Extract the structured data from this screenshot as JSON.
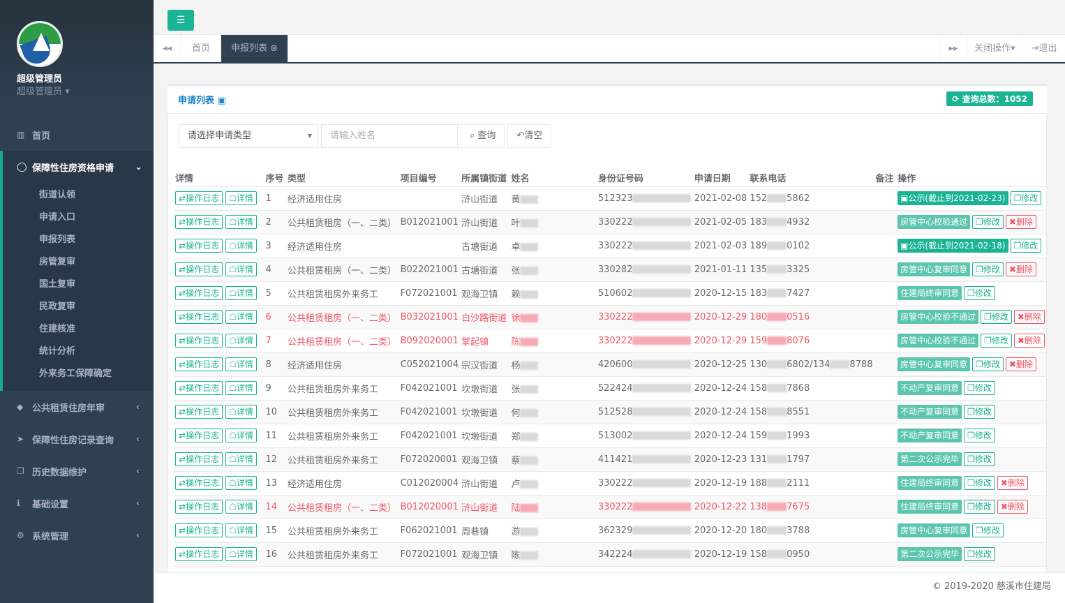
{
  "user": {
    "name": "超级管理员",
    "role": "超级管理员"
  },
  "nav": {
    "home": "首页",
    "active": "保障性住房资格申请",
    "sub": [
      "街道认领",
      "申请入口",
      "申报列表",
      "房管复审",
      "国土复审",
      "民政复审",
      "住建核准",
      "统计分析",
      "外来务工保障确定"
    ],
    "rest": [
      "公共租赁住房年审",
      "保障性住房记录查询",
      "历史数据维护",
      "基础设置",
      "系统管理"
    ]
  },
  "tabs": {
    "home": "首页",
    "active": "申报列表",
    "close_ops": "关闭操作",
    "logout": "退出"
  },
  "panel": {
    "title": "申请列表",
    "count": "查询总数：1052"
  },
  "search": {
    "type_placeholder": "请选择申请类型",
    "name_placeholder": "请输入姓名",
    "query": "查询",
    "clear": "清空"
  },
  "columns": [
    "详情",
    "序号",
    "类型",
    "项目编号",
    "所属镇街道",
    "姓名",
    "身份证号码",
    "申请日期",
    "联系电话",
    "备注",
    "操作"
  ],
  "row_buttons": {
    "log": "操作日志",
    "detail": "详情",
    "edit": "修改",
    "delete": "删除"
  },
  "rows": [
    {
      "no": "1",
      "type": "经济适用住房",
      "proj": "",
      "street": "浒山街道",
      "name": "黄",
      "id": "512323",
      "date": "2021-02-08",
      "p1": "152",
      "p2": "5862",
      "status": "公示(截止到2021-02-23)",
      "del": false,
      "red": false
    },
    {
      "no": "2",
      "type": "公共租赁租房（一、二类）",
      "proj": "B012021001",
      "street": "浒山街道",
      "name": "叶",
      "id": "330222",
      "date": "2021-02-05",
      "p1": "183",
      "p2": "4932",
      "status": "房管中心校验通过",
      "del": true,
      "red": false
    },
    {
      "no": "3",
      "type": "经济适用住房",
      "proj": "",
      "street": "古塘街道",
      "name": "卓",
      "id": "330222",
      "date": "2021-02-03",
      "p1": "189",
      "p2": "0102",
      "status": "公示(截止到2021-02-18)",
      "del": false,
      "red": false
    },
    {
      "no": "4",
      "type": "公共租赁租房（一、二类）",
      "proj": "B022021001",
      "street": "古塘街道",
      "name": "张",
      "id": "330282",
      "date": "2021-01-11",
      "p1": "135",
      "p2": "3325",
      "status": "房管中心复审同意",
      "del": true,
      "red": false
    },
    {
      "no": "5",
      "type": "公共租赁租房外来务工",
      "proj": "F072021001",
      "street": "观海卫镇",
      "name": "赖",
      "id": "510602",
      "date": "2020-12-15",
      "p1": "183",
      "p2": "7427",
      "status": "住建局终审同意",
      "del": false,
      "red": false
    },
    {
      "no": "6",
      "type": "公共租赁租房（一、二类）",
      "proj": "B032021001",
      "street": "白沙路街道",
      "name": "徐",
      "id": "330222",
      "date": "2020-12-29",
      "p1": "180",
      "p2": "0516",
      "status": "房管中心校验不通过",
      "del": true,
      "red": true
    },
    {
      "no": "7",
      "type": "公共租赁租房（一、二类）",
      "proj": "B092020001",
      "street": "掌起镇",
      "name": "陈",
      "id": "330222",
      "date": "2020-12-29",
      "p1": "159",
      "p2": "8076",
      "status": "房管中心校验不通过",
      "del": true,
      "red": true
    },
    {
      "no": "8",
      "type": "经济适用住房",
      "proj": "C052021004",
      "street": "宗汉街道",
      "name": "杨",
      "id": "420600",
      "date": "2020-12-25",
      "p1": "130",
      "p2": "6802/134",
      "p3": "8788",
      "status": "房管中心复审同意",
      "del": true,
      "red": false
    },
    {
      "no": "9",
      "type": "公共租赁租房外来务工",
      "proj": "F042021001",
      "street": "坎墩街道",
      "name": "张",
      "id": "522424",
      "date": "2020-12-24",
      "p1": "158",
      "p2": "7868",
      "status": "不动产复审同意",
      "del": false,
      "red": false
    },
    {
      "no": "10",
      "type": "公共租赁租房外来务工",
      "proj": "F042021001",
      "street": "坎墩街道",
      "name": "何",
      "id": "512528",
      "date": "2020-12-24",
      "p1": "158",
      "p2": "8551",
      "status": "不动产复审同意",
      "del": false,
      "red": false
    },
    {
      "no": "11",
      "type": "公共租赁租房外来务工",
      "proj": "F042021001",
      "street": "坎墩街道",
      "name": "郑",
      "id": "513002",
      "date": "2020-12-24",
      "p1": "159",
      "p2": "1993",
      "status": "不动产复审同意",
      "del": false,
      "red": false
    },
    {
      "no": "12",
      "type": "公共租赁租房外来务工",
      "proj": "F072020001",
      "street": "观海卫镇",
      "name": "蔡",
      "id": "411421",
      "date": "2020-12-23",
      "p1": "131",
      "p2": "1797",
      "status": "第二次公示完毕",
      "del": false,
      "red": false
    },
    {
      "no": "13",
      "type": "经济适用住房",
      "proj": "C012020004",
      "street": "浒山街道",
      "name": "卢",
      "id": "330222",
      "date": "2020-12-19",
      "p1": "188",
      "p2": "2111",
      "status": "住建局终审同意",
      "del": true,
      "red": false
    },
    {
      "no": "14",
      "type": "公共租赁租房（一、二类）",
      "proj": "B012020001",
      "street": "浒山街道",
      "name": "陆",
      "id": "330222",
      "date": "2020-12-22",
      "p1": "138",
      "p2": "7675",
      "status": "住建局终审同意",
      "del": true,
      "red": true
    },
    {
      "no": "15",
      "type": "公共租赁租房外来务工",
      "proj": "F062021001",
      "street": "周巷镇",
      "name": "游",
      "id": "362329",
      "date": "2020-12-20",
      "p1": "180",
      "p2": "3788",
      "status": "房管中心复审同意",
      "del": false,
      "red": false
    },
    {
      "no": "16",
      "type": "公共租赁租房外来务工",
      "proj": "F072021001",
      "street": "观海卫镇",
      "name": "陈",
      "id": "342224",
      "date": "2020-12-19",
      "p1": "158",
      "p2": "0950",
      "status": "第二次公示完毕",
      "del": false,
      "red": false
    }
  ],
  "footer": "© 2019-2020 慈溪市住建局"
}
